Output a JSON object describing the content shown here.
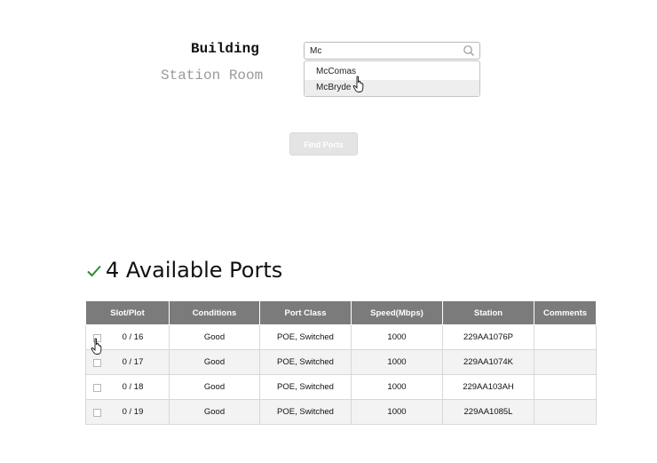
{
  "form": {
    "building_label": "Building",
    "station_room_label": "Station Room",
    "search_value": "Mc",
    "suggestions": [
      "McComas",
      "McBryde"
    ],
    "find_button": "Find Ports"
  },
  "results": {
    "title": "4 Available Ports",
    "columns": [
      "Slot/Plot",
      "Conditions",
      "Port Class",
      "Speed(Mbps)",
      "Station",
      "Comments"
    ],
    "rows": [
      {
        "slot": "0 / 16",
        "condition": "Good",
        "port_class": "POE, Switched",
        "speed": "1000",
        "station": "229AA1076P",
        "comments": ""
      },
      {
        "slot": "0 / 17",
        "condition": "Good",
        "port_class": "POE, Switched",
        "speed": "1000",
        "station": "229AA1074K",
        "comments": ""
      },
      {
        "slot": "0 / 18",
        "condition": "Good",
        "port_class": "POE, Switched",
        "speed": "1000",
        "station": "229AA103AH",
        "comments": ""
      },
      {
        "slot": "0 / 19",
        "condition": "Good",
        "port_class": "POE, Switched",
        "speed": "1000",
        "station": "229AA1085L",
        "comments": ""
      }
    ]
  },
  "colors": {
    "header_bg": "#7b7b7b",
    "check_green": "#2e8b2e",
    "button_disabled": "#e4e4e4"
  }
}
